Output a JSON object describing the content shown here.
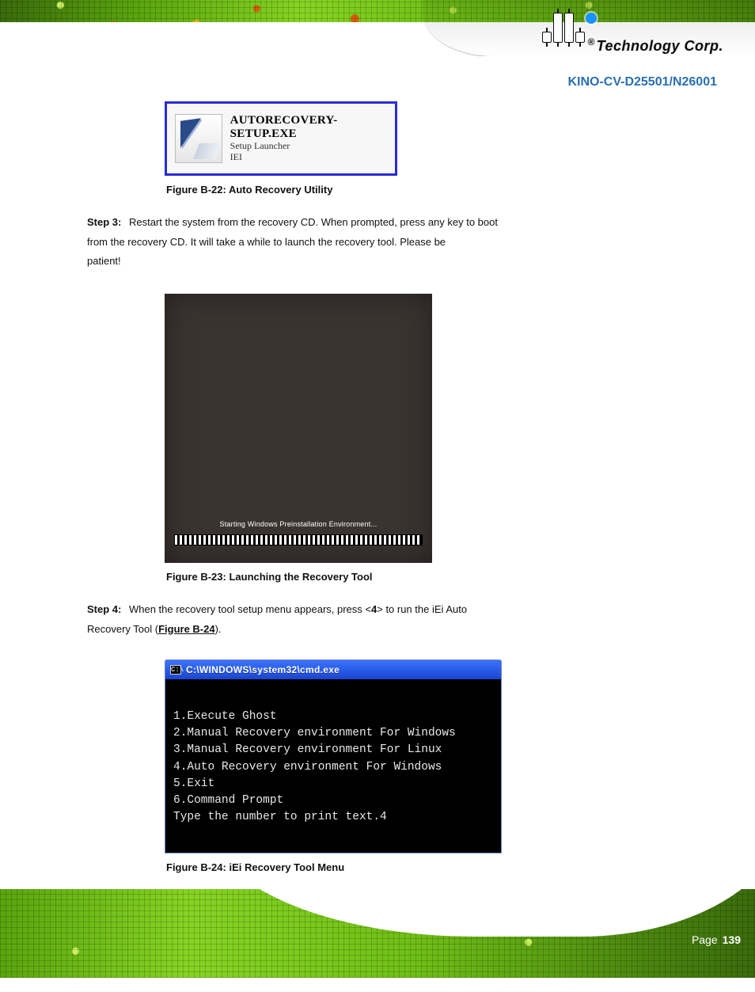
{
  "brand": {
    "logo_r": "®",
    "logo_text": "Technology Corp.",
    "product_title": "KINO-CV-D25501/N26001"
  },
  "figure22": {
    "setup_title": "AUTORECOVERY-SETUP.EXE",
    "setup_sub1": "Setup Launcher",
    "setup_sub2": "IEI",
    "caption": "Figure B-22: Auto Recovery Utility"
  },
  "step3": {
    "num": "Step 3:",
    "line1_a": "Restart the system from the recovery CD. When prompted, press any key to boot",
    "line2_a": "from the recovery CD. It will take a while to launch the recovery tool. Please be",
    "line3_a": "patient!"
  },
  "figure23": {
    "winpe_line": "Starting Windows Preinstallation Environment...",
    "caption": "Figure B-23: Launching the Recovery Tool"
  },
  "step4": {
    "num": "Step 4:",
    "text_a": "When the recovery tool setup menu appears, press <",
    "key": "4",
    "text_b": "> to run the iEi Auto",
    "text_c": "Recovery Tool (",
    "figref": "Figure B-24",
    "text_d": ")."
  },
  "figure24": {
    "window_title": "C:\\WINDOWS\\system32\\cmd.exe",
    "cmd_icon": "C:\\",
    "lines": {
      "l0": "",
      "l1": "1.Execute Ghost",
      "l2": "2.Manual Recovery environment For Windows",
      "l3": "3.Manual Recovery environment For Linux",
      "l4": "4.Auto Recovery environment For Windows",
      "l5": "5.Exit",
      "l6": "6.Command Prompt",
      "l7": "Type the number to print text.4"
    },
    "caption": "Figure B-24: iEi Recovery Tool Menu"
  },
  "footer": {
    "page_label": "Page",
    "page_number": "139"
  }
}
